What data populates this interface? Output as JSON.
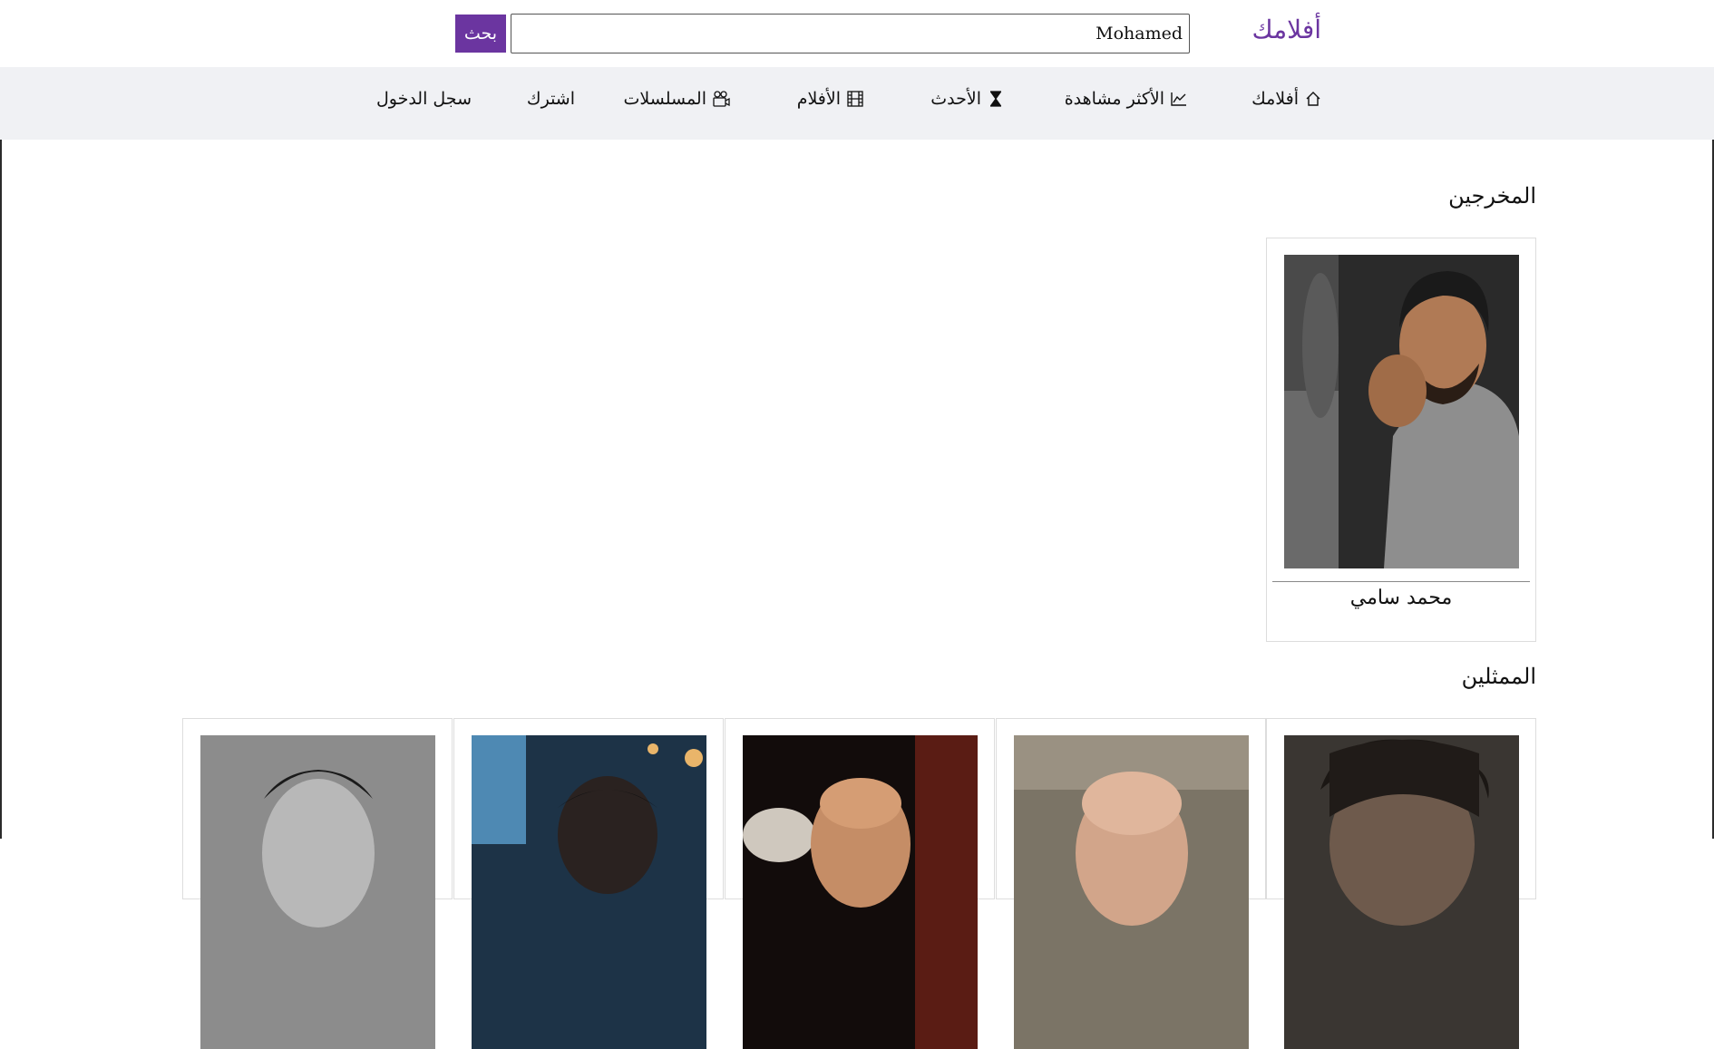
{
  "header": {
    "logo": "أفلامك",
    "search": {
      "value": "Mohamed",
      "button_label": "بحث"
    }
  },
  "nav": {
    "items": [
      {
        "label": "أفلامك",
        "icon": "home-icon"
      },
      {
        "label": "الأكثر مشاهدة",
        "icon": "trending-chart-icon"
      },
      {
        "label": "الأحدث",
        "icon": "hourglass-icon"
      },
      {
        "label": "الأفلام",
        "icon": "film-icon"
      },
      {
        "label": "المسلسلات",
        "icon": "camera-reel-icon"
      },
      {
        "label": "اشترك",
        "icon": ""
      },
      {
        "label": "سجل الدخول",
        "icon": ""
      }
    ]
  },
  "directors": {
    "title": "المخرجين",
    "items": [
      {
        "name": "محمد سامي"
      }
    ]
  },
  "actors": {
    "title": "الممثلين",
    "items": [
      {},
      {},
      {},
      {},
      {}
    ]
  },
  "colors": {
    "accent": "#6b35a0",
    "nav_bg": "#f0f1f4"
  }
}
